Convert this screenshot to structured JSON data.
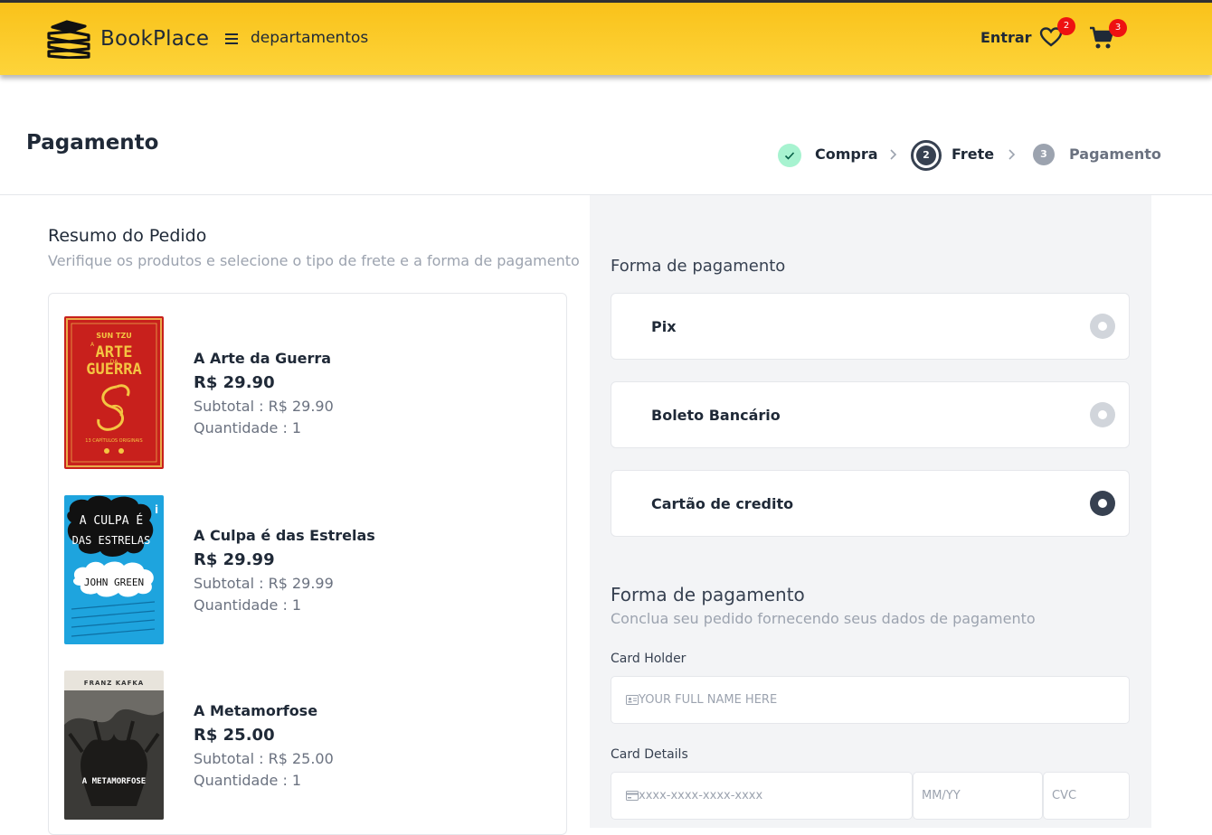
{
  "header": {
    "brand": "BookPlace",
    "departments_label": "departamentos",
    "login_label": "Entrar",
    "favorites_count": "2",
    "cart_count": "3"
  },
  "page": {
    "title": "Pagamento",
    "steps": [
      {
        "label": "Compra",
        "state": "done"
      },
      {
        "number": "2",
        "label": "Frete",
        "state": "current"
      },
      {
        "number": "3",
        "label": "Pagamento",
        "state": "todo"
      }
    ]
  },
  "summary": {
    "title": "Resumo do Pedido",
    "subtitle": "Verifique os produtos e selecione o tipo de frete e a forma de pagamento",
    "items": [
      {
        "name": "A Arte da Guerra",
        "price": "R$ 29.90",
        "subtotal": "Subtotal : R$ 29.90",
        "quantity": "Quantidade : 1",
        "cover": {
          "author": "SUN TZU",
          "title_line1": "ARTE",
          "title_line2": "GUERRA",
          "title_prefix": "A",
          "title_mid": "DA",
          "note": "13 CAPÍTULOS ORIGINAIS"
        }
      },
      {
        "name": "A Culpa é das Estrelas",
        "price": "R$ 29.99",
        "subtotal": "Subtotal : R$ 29.99",
        "quantity": "Quantidade : 1",
        "cover": {
          "title_line1": "A CULPA É",
          "title_line2": "DAS ESTRELAS",
          "author": "JOHN GREEN",
          "publisher": "i"
        }
      },
      {
        "name": "A Metamorfose",
        "price": "R$ 25.00",
        "subtotal": "Subtotal : R$ 25.00",
        "quantity": "Quantidade : 1",
        "cover": {
          "author": "FRANZ KAFKA",
          "title": "A METAMORFOSE"
        }
      }
    ]
  },
  "payment": {
    "title": "Forma de pagamento",
    "options": [
      {
        "label": "Pix",
        "selected": false
      },
      {
        "label": "Boleto Bancário",
        "selected": false
      },
      {
        "label": "Cartão de credito",
        "selected": true
      }
    ]
  },
  "card": {
    "title": "Forma de pagamento",
    "subtitle": "Conclua seu pedido fornecendo seus dados de pagamento",
    "holder_label": "Card Holder",
    "holder_placeholder": "YOUR FULL NAME HERE",
    "details_label": "Card Details",
    "number_placeholder": "xxxx-xxxx-xxxx-xxxx",
    "expiry_placeholder": "MM/YY",
    "cvc_placeholder": "CVC"
  },
  "colors": {
    "header_yellow": "#fdd43a",
    "accent_dark": "#374151",
    "badge_red": "#ee1111",
    "success_green": "#a7f3d0"
  }
}
